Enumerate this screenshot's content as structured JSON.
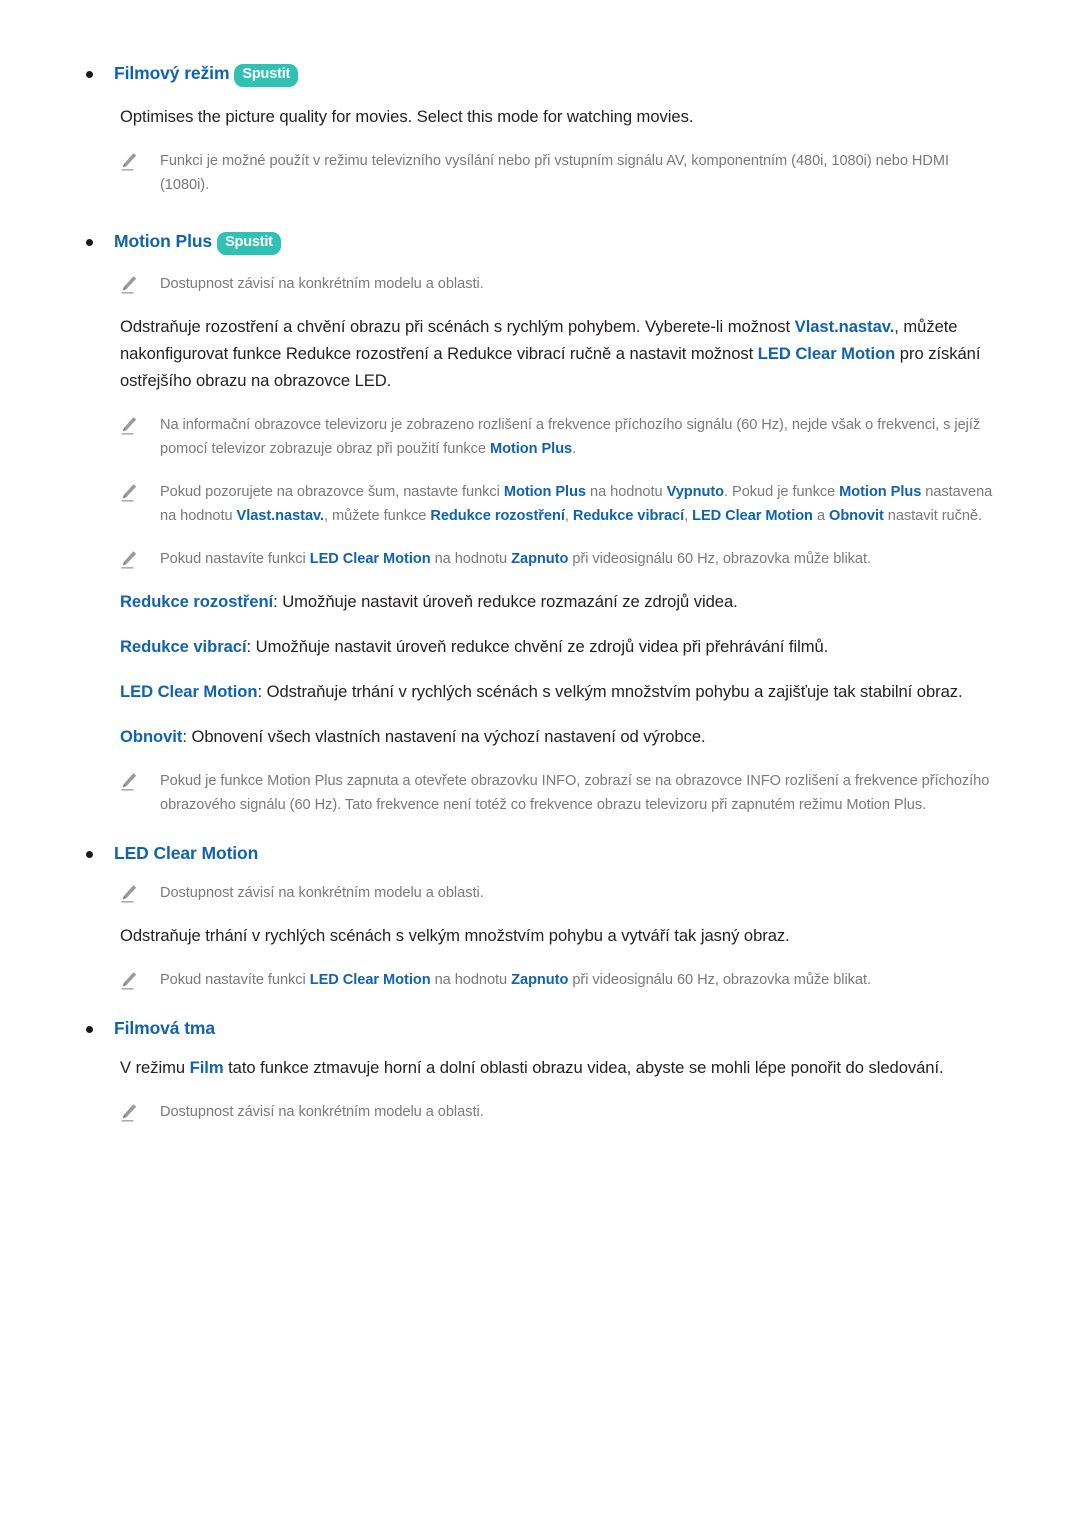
{
  "page": {
    "language": "cs",
    "colors": {
      "heading_blue": "#1263ad",
      "badge_teal": "#31c0b4",
      "body_text": "#231f20",
      "note_text": "#7a7a7a",
      "bullet": "#1a1a1a"
    }
  },
  "sections": {
    "film_mode": {
      "heading": "Filmový režim",
      "badge": "Spustit",
      "body": "Optimises the picture quality for movies. Select this mode for watching movies.",
      "note": "Funkci je možné použít v režimu televizního vysílání nebo při vstupním signálu AV, komponentním (480i, 1080i) nebo HDMI (1080i)."
    },
    "motion_plus": {
      "heading": "Motion Plus",
      "badge": "Spustit",
      "availability_note": "Dostupnost závisí na konkrétním modelu a oblasti.",
      "body_1": "Odstraňuje rozostření a chvění obrazu při scénách s rychlým pohybem. Vyberete-li možnost ",
      "body_term_1": "Vlast.nastav.",
      "body_2": ", můžete nakonfigurovat funkce Redukce rozostření a Redukce vibrací ručně a nastavit možnost ",
      "body_term_2": "LED Clear Motion",
      "body_3": " pro získání ostřejšího obrazu na obrazovce LED.",
      "note_1_a": "Na informační obrazovce televizoru je zobrazeno rozlišení a frekvence příchozího signálu (60 Hz), nejde však o frekvenci, s jejíž pomocí televizor zobrazuje obraz při použití funkce ",
      "note_1_term": "Motion Plus",
      "note_1_b": ".",
      "note_2_a": "Pokud pozorujete na obrazovce šum, nastavte funkci ",
      "note_2_term_1": "Motion Plus",
      "note_2_b": " na hodnotu ",
      "note_2_term_2": "Vypnuto",
      "note_2_c": ". Pokud je funkce ",
      "note_2_term_3": "Motion Plus",
      "note_2_d": " nastavena na hodnotu ",
      "note_2_term_4": "Vlast.nastav.",
      "note_2_e": ", můžete funkce ",
      "note_2_term_5": "Redukce rozostření",
      "note_2_f": ", ",
      "note_2_term_6": "Redukce vibrací",
      "note_2_g": ", ",
      "note_2_term_7": "LED Clear Motion",
      "note_2_h": " a ",
      "note_2_term_8": "Obnovit",
      "note_2_i": " nastavit ručně.",
      "note_3_a": "Pokud nastavíte funkci ",
      "note_3_term_1": "LED Clear Motion",
      "note_3_b": " na hodnotu ",
      "note_3_term_2": "Zapnuto",
      "note_3_c": " při videosignálu 60 Hz, obrazovka může blikat.",
      "def_blur_term": "Redukce rozostření",
      "def_blur_text": ": Umožňuje nastavit úroveň redukce rozmazání ze zdrojů videa.",
      "def_judder_term": "Redukce vibrací",
      "def_judder_text": ": Umožňuje nastavit úroveň redukce chvění ze zdrojů videa při přehrávání filmů.",
      "def_lcm_term": "LED Clear Motion",
      "def_lcm_text": ": Odstraňuje trhání v rychlých scénách s velkým množstvím pohybu a zajišťuje tak stabilní obraz.",
      "def_reset_term": "Obnovit",
      "def_reset_text": ": Obnovení všech vlastních nastavení na výchozí nastavení od výrobce.",
      "note_4": "Pokud je funkce Motion Plus zapnuta a otevřete obrazovku INFO, zobrazí se na obrazovce INFO rozlišení a frekvence příchozího obrazového signálu (60 Hz). Tato frekvence není totéž co frekvence obrazu televizoru při zapnutém režimu Motion Plus."
    },
    "led_clear_motion": {
      "heading": "LED Clear Motion",
      "availability_note": "Dostupnost závisí na konkrétním modelu a oblasti.",
      "body": "Odstraňuje trhání v rychlých scénách s velkým množstvím pohybu a vytváří tak jasný obraz.",
      "note_a": "Pokud nastavíte funkci ",
      "note_term_1": "LED Clear Motion",
      "note_b": " na hodnotu ",
      "note_term_2": "Zapnuto",
      "note_c": " při videosignálu 60 Hz, obrazovka může blikat."
    },
    "film_darkness": {
      "heading": "Filmová tma",
      "body_a": "V režimu ",
      "body_term": "Film",
      "body_b": " tato funkce ztmavuje horní a dolní oblasti obrazu videa, abyste se mohli lépe ponořit do sledování.",
      "availability_note": "Dostupnost závisí na konkrétním modelu a oblasti."
    }
  }
}
